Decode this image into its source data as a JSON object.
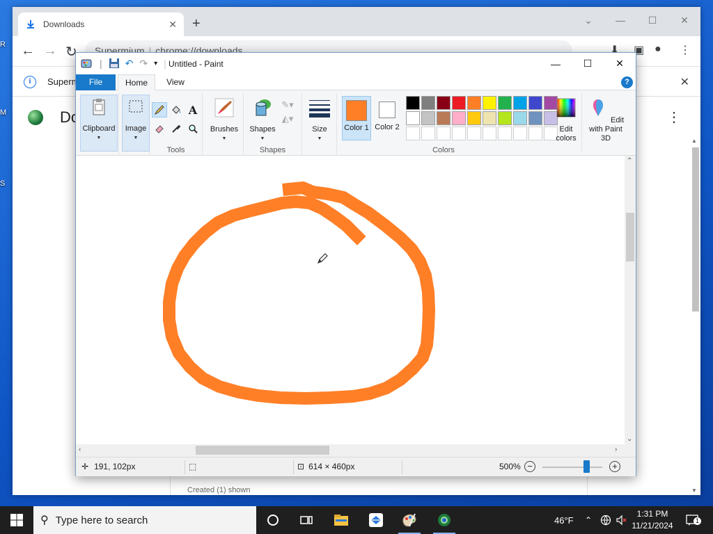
{
  "desktop": {
    "left_labels": [
      "R",
      "M",
      "S"
    ]
  },
  "browser": {
    "tab": {
      "title": "Downloads"
    },
    "address": {
      "site": "Supermium",
      "url": "chrome://downloads"
    },
    "infobar": {
      "text": "Superm"
    },
    "page": {
      "title": "Do"
    },
    "card_label": "Created (1) shown"
  },
  "paint": {
    "window_title": "Untitled - Paint",
    "menu": {
      "file": "File",
      "home": "Home",
      "view": "View"
    },
    "ribbon": {
      "clipboard": "Clipboard",
      "image": "Image",
      "tools_label": "Tools",
      "brushes": "Brushes",
      "shapes": "Shapes",
      "shapes_label": "Shapes",
      "size": "Size",
      "color1": "Color 1",
      "color2": "Color 2",
      "colors_label": "Colors",
      "edit_colors": "Edit colors",
      "edit_3d": "Edit with Paint 3D"
    },
    "color1_value": "#ff7f27",
    "color2_value": "#ffffff",
    "palette_row1": [
      "#000000",
      "#7f7f7f",
      "#880015",
      "#ed1c24",
      "#ff7f27",
      "#fff200",
      "#22b14c",
      "#00a2e8",
      "#3f48cc",
      "#a349a4"
    ],
    "palette_row2": [
      "#ffffff",
      "#c3c3c3",
      "#b97a57",
      "#ffaec9",
      "#ffc90e",
      "#efe4b0",
      "#b5e61d",
      "#99d9ea",
      "#7092be",
      "#c8bfe7"
    ],
    "palette_row3": [
      "#ffffff",
      "#ffffff",
      "#ffffff",
      "#ffffff",
      "#ffffff",
      "#ffffff",
      "#ffffff",
      "#ffffff",
      "#ffffff",
      "#ffffff"
    ],
    "stroke_color": "#ff7f27",
    "status": {
      "cursor_pos": "191, 102px",
      "canvas_size": "614 × 460px",
      "zoom": "500%"
    }
  },
  "taskbar": {
    "search_placeholder": "Type here to search",
    "weather": "46°F",
    "time": "1:31 PM",
    "date": "11/21/2024",
    "notification_count": "1"
  }
}
